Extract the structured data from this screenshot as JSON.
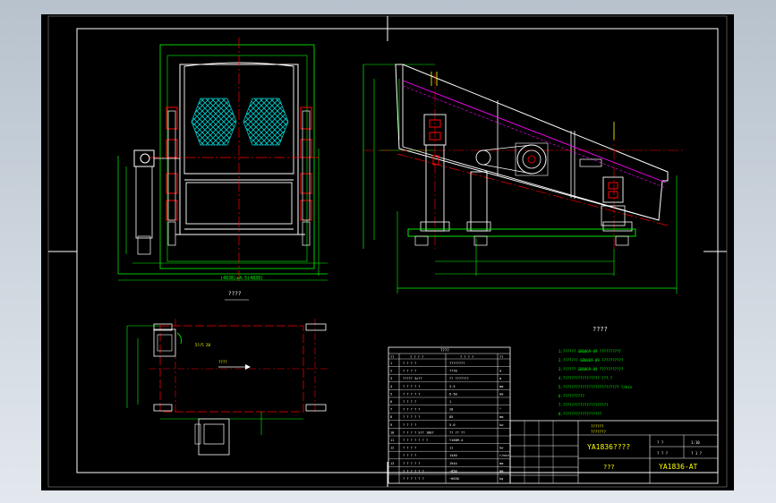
{
  "drawing": {
    "front_view_caption": "????",
    "front_dim_bottom": "(4838)±4.5(4838)",
    "plan_note_a": "5?/5   20",
    "plan_arrow_label": "????",
    "notes_title": "????",
    "notes": [
      "1.??????   GB6069-89 ??????????",
      "2.???????   GB6069-89 ??????????",
      "3.??????   GB6069-89 ???????????",
      "4.?????????????????   ???.?",
      "5.??????????????????????????   ?/min",
      "6.??????????",
      "7.?????????????????????",
      "8.??????????????????"
    ]
  },
  "parts_table": {
    "title": "????",
    "header": [
      "??",
      "? ? ? ?",
      "? ? ? ?",
      "??"
    ],
    "rows": [
      [
        "1",
        "? ? ? ?",
        "????????",
        ""
      ],
      [
        "2",
        "? ? ? ?",
        "???0",
        "m"
      ],
      [
        "3",
        "????? 3×?7",
        "?? ???????",
        "m"
      ],
      [
        "4",
        "? ? ? ? ?",
        "3.5",
        "mm"
      ],
      [
        "5",
        "? ? ? ? ?",
        "6-50",
        "mm"
      ],
      [
        "6",
        "? ? ? ?",
        "1",
        ""
      ],
      [
        "7",
        "? ? ? ? ?",
        "20",
        "°"
      ],
      [
        "8",
        "? ? ? ? ?",
        "85",
        "mm"
      ],
      [
        "9",
        "? ? ? ?",
        "5.0",
        "kw"
      ],
      [
        "10",
        "? ? ? ?   S?? 180?",
        "?? ?? ??",
        ""
      ],
      [
        "11",
        "? ? ? ? ? ? ?",
        "Y160M-4",
        ""
      ],
      [
        "12",
        "? ? ? ?",
        "11",
        "kw"
      ],
      [
        "",
        "? ? ? ?",
        "1440",
        "r/min"
      ],
      [
        "13",
        "? ? ? ? ?",
        "1944",
        "mm"
      ],
      [
        "",
        "? ? ? ? ? ?",
        "~850",
        "mm"
      ],
      [
        "",
        "? ? ? ? ? ?",
        "~6630",
        "kg"
      ]
    ]
  },
  "title_block": {
    "company": "??????",
    "subtitle": "???????",
    "drawing_name": "YA1836????",
    "drawing_name_2": "???",
    "drawing_number": "YA1836-AT",
    "scale_label": "? ?",
    "scale_value": "1:10",
    "sheet_label": "? ? ?",
    "sheet_value": "? 1 ?"
  },
  "colors": {
    "background": "#000000",
    "frame": "#ffffff",
    "green": "#00ff00",
    "red": "#ff0000",
    "cyan": "#00c8c8",
    "magenta": "#ff00ff",
    "yellow": "#ffff00"
  }
}
